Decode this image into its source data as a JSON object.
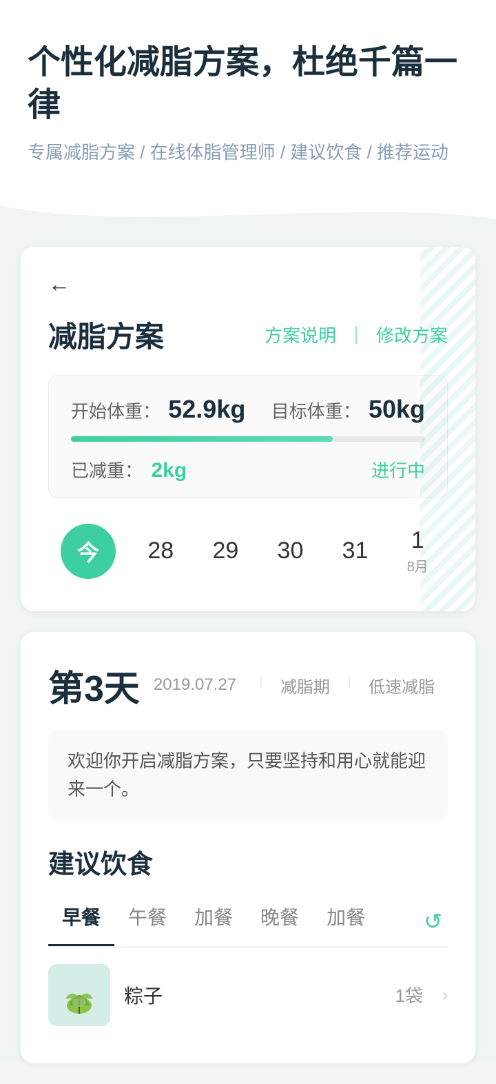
{
  "header": {
    "title": "个性化减脂方案，杜绝千篇一律",
    "subtitle": "专属减脂方案 / 在线体脂管理师 / 建议饮食 / 推荐运动"
  },
  "plan": {
    "back_label": "←",
    "title": "减脂方案",
    "action_explain": "方案说明",
    "action_separator": "｜",
    "action_modify": "修改方案",
    "start_weight_label": "开始体重：",
    "start_weight_value": "52.9kg",
    "target_weight_label": "目标体重：",
    "target_weight_value": "50kg",
    "progress_percent": 74,
    "reduced_label": "已减重：",
    "reduced_value": "2kg",
    "status": "进行中"
  },
  "calendar": {
    "today_label": "今",
    "dates": [
      {
        "number": "28",
        "month": ""
      },
      {
        "number": "29",
        "month": ""
      },
      {
        "number": "30",
        "month": ""
      },
      {
        "number": "31",
        "month": ""
      },
      {
        "number": "1",
        "month": "8月"
      }
    ]
  },
  "day": {
    "day_number": "第3天",
    "date": "2019.07.27",
    "separator1": "｜",
    "tag1": "减脂期",
    "separator2": "｜",
    "tag2": "低速减脂",
    "message": "欢迎你开启减脂方案，只要坚持和用心就能迎来一个。"
  },
  "diet": {
    "section_title": "建议饮食",
    "tabs": [
      {
        "label": "早餐",
        "active": true
      },
      {
        "label": "午餐",
        "active": false
      },
      {
        "label": "加餐",
        "active": false
      },
      {
        "label": "晚餐",
        "active": false
      },
      {
        "label": "加餐",
        "active": false
      }
    ],
    "refresh_icon": "↺",
    "food_items": [
      {
        "name": "粽子",
        "amount": "1袋",
        "has_image": true
      }
    ]
  },
  "colors": {
    "accent": "#3ecfa0",
    "text_primary": "#1a2e3b",
    "text_secondary": "#888888"
  }
}
